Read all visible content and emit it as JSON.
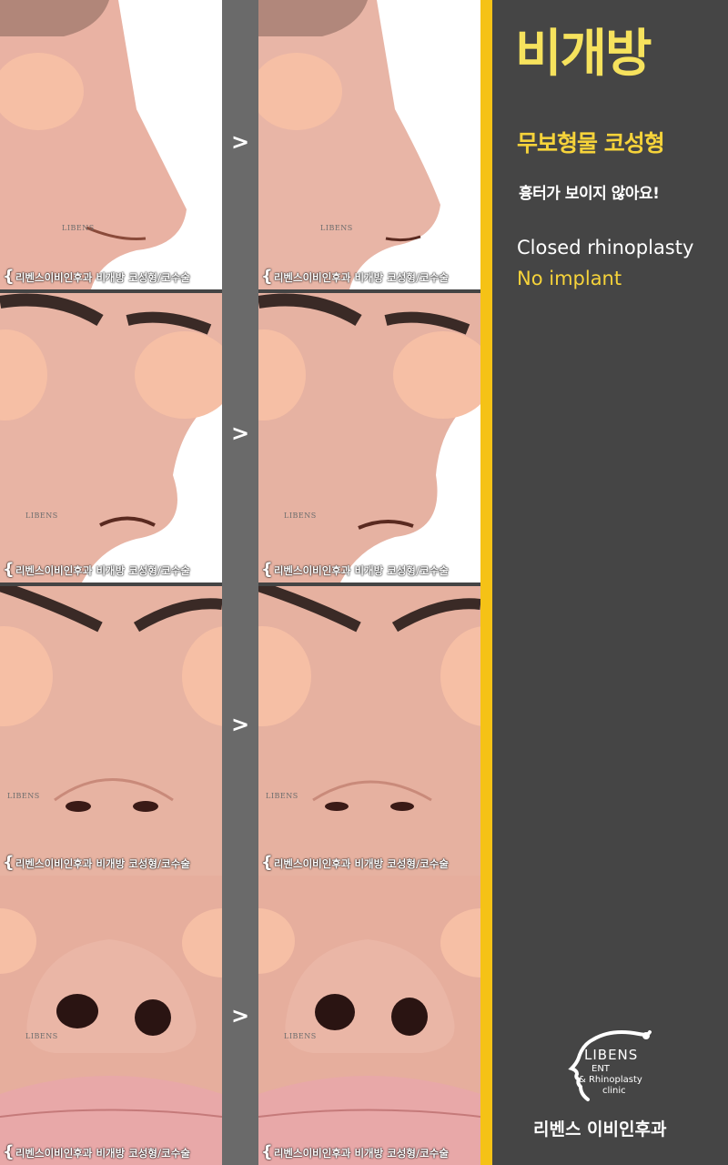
{
  "title": "비개방",
  "subtitle": "무보형물 코성형",
  "tagline": "흉터가 보이지 않아요!",
  "english_line_1": "Closed rhinoplasty",
  "english_line_2": "No implant",
  "logo": {
    "name": "LIBENS",
    "line1": "ENT",
    "line2": "& Rhinoplasty",
    "line3": "clinic"
  },
  "clinic_name": "리벤스 이비인후과",
  "comparison_arrow": ">",
  "watermark": "리벤스이비인후과  비개방 코성형/코수술",
  "photo_logo": "LIBENS",
  "photo_rows": [
    {
      "view": "side"
    },
    {
      "view": "oblique"
    },
    {
      "view": "front"
    },
    {
      "view": "base"
    }
  ],
  "colors": {
    "accent_yellow": "#f5c216",
    "title_yellow": "#f6e25d",
    "panel_bg": "#454545",
    "divider": "#6a6a6a"
  }
}
